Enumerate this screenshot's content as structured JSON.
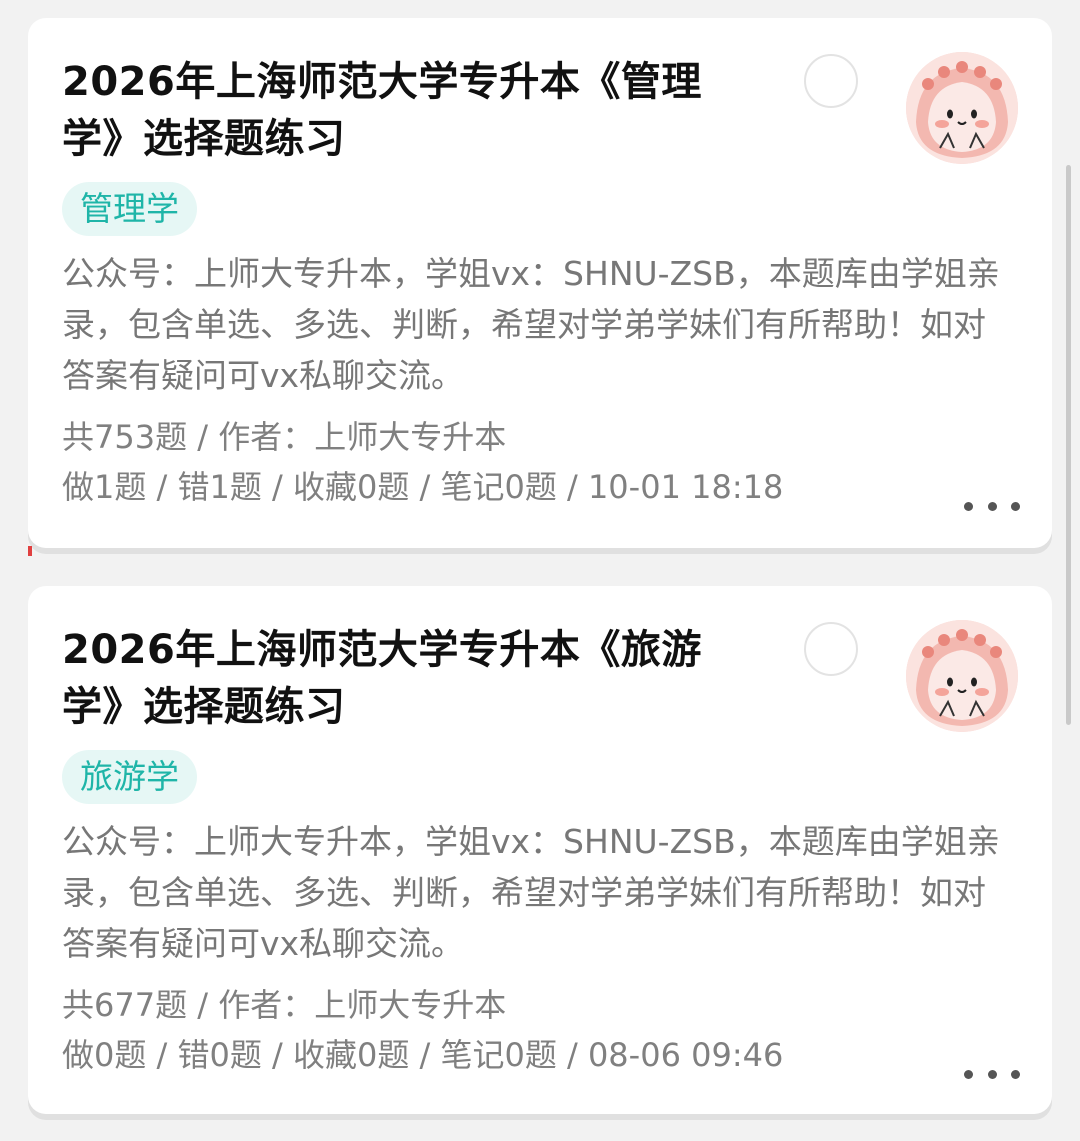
{
  "cards": [
    {
      "title": "2026年上海师范大学专升本《管理学》选择题练习",
      "tag": "管理学",
      "description": "公众号：上师大专升本，学姐vx：SHNU-ZSB，本题库由学姐亲录，包含单选、多选、判断，希望对学弟学妹们有所帮助！如对答案有疑问可vx私聊交流。",
      "meta_line1": "共753题 / 作者：上师大专升本",
      "meta_line2": "做1题 / 错1题 / 收藏0题 / 笔记0题 / 10-01 18:18",
      "avatar_icon": "pink-blob-avatar-icon",
      "more_icon": "more-dots-icon"
    },
    {
      "title": "2026年上海师范大学专升本《旅游学》选择题练习",
      "tag": "旅游学",
      "description": "公众号：上师大专升本，学姐vx：SHNU-ZSB，本题库由学姐亲录，包含单选、多选、判断，希望对学弟学妹们有所帮助！如对答案有疑问可vx私聊交流。",
      "meta_line1": "共677题 / 作者：上师大专升本",
      "meta_line2": "做0题 / 错0题 / 收藏0题 / 笔记0题 / 08-06 09:46",
      "avatar_icon": "pink-blob-avatar-icon",
      "more_icon": "more-dots-icon"
    }
  ],
  "colors": {
    "tag_bg": "#e6f7f5",
    "tag_text": "#1fb5a8",
    "title": "#111111",
    "secondary_text": "#777777"
  }
}
